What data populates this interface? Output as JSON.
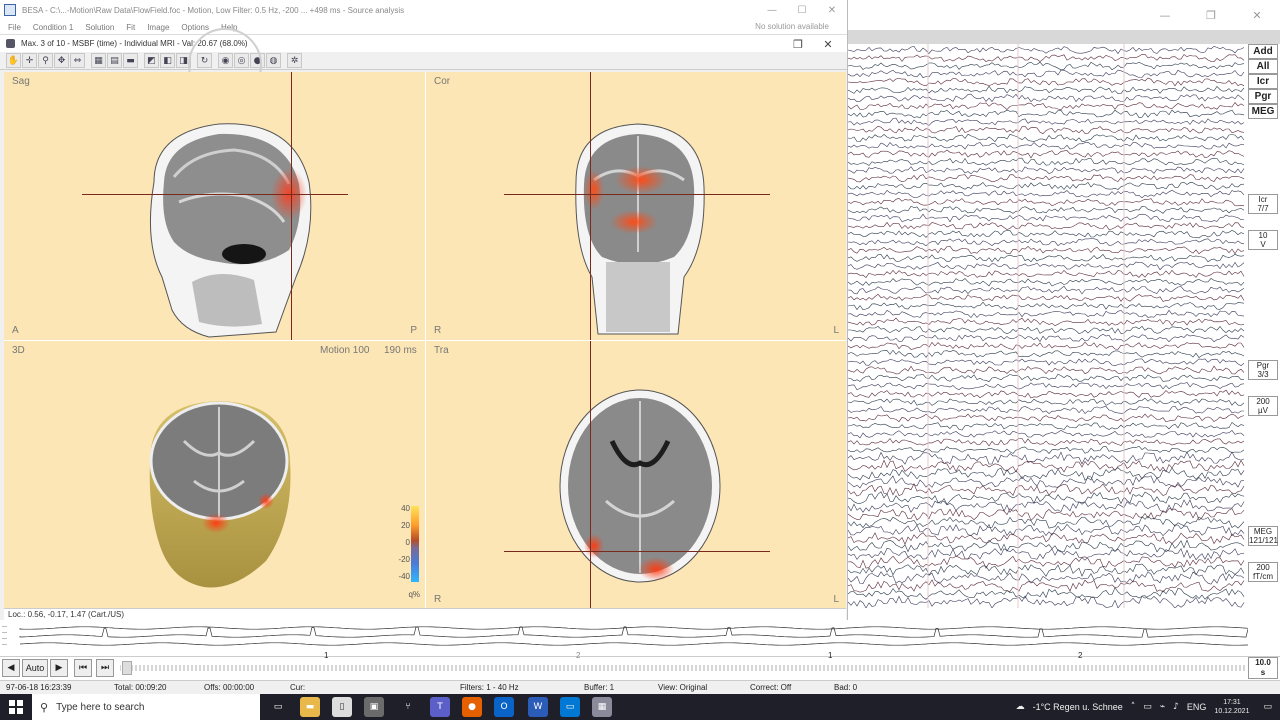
{
  "background_window": {
    "side_buttons": [
      "Add",
      "All",
      "Icr",
      "Pgr",
      "MEG"
    ],
    "icr_block": [
      "Icr",
      "7/7"
    ],
    "scale_icr": [
      "10",
      "V"
    ],
    "pgr_block": [
      "Pgr",
      "3/3"
    ],
    "scale_pgr": [
      "200",
      "µV"
    ],
    "meg_block": [
      "MEG",
      "121/121"
    ],
    "scale_meg": [
      "200",
      "fT/cm"
    ]
  },
  "besa": {
    "title": "BESA - C:\\...-Motion\\Raw Data\\FlowField.foc - Motion, Low Filter: 0.5 Hz, -200 ... +498 ms - Source analysis",
    "menu": [
      "File",
      "Condition 1",
      "Solution",
      "Fit",
      "Image",
      "Options",
      "Help"
    ],
    "no_solution": "No solution available",
    "sub_title": "Max. 3 of 10 - MSBF (time) - Individual MRI - Val: 20.67 (68.0%)",
    "panels": {
      "sag": {
        "name": "Sag",
        "left": "A",
        "right": "P"
      },
      "cor": {
        "name": "Cor",
        "left": "R",
        "right": "L"
      },
      "three_d": {
        "name": "3D",
        "info": "Motion 100",
        "time": "190 ms"
      },
      "tra": {
        "name": "Tra",
        "left": "R",
        "right": "L"
      }
    },
    "colorbar": {
      "labels": [
        "40",
        "20",
        "0",
        "-20",
        "-40"
      ],
      "unit": "q%"
    },
    "loc": "Loc.: 0.56, -0.17, 1.47  (Cart./US)"
  },
  "nav": {
    "auto": "Auto",
    "markers": [
      "1",
      "2",
      "1",
      "2"
    ],
    "time_scale": [
      "10.0",
      "s"
    ]
  },
  "status": {
    "datetime": "97-06-18 16:23:39",
    "total": "Total: 00:09:20",
    "offs": "Offs: 00:00:00",
    "cur": "Cur:",
    "filters": "Filters: 1 - 40 Hz",
    "buffer": "Buffer: 1",
    "view": "View: Original",
    "correct": "Correct: Off",
    "bad": "Bad: 0"
  },
  "taskbar": {
    "search_placeholder": "Type here to search",
    "weather": "-1°C  Regen u. Schnee",
    "lang": "ENG",
    "time": "17:31",
    "date": "10.12.2021"
  }
}
